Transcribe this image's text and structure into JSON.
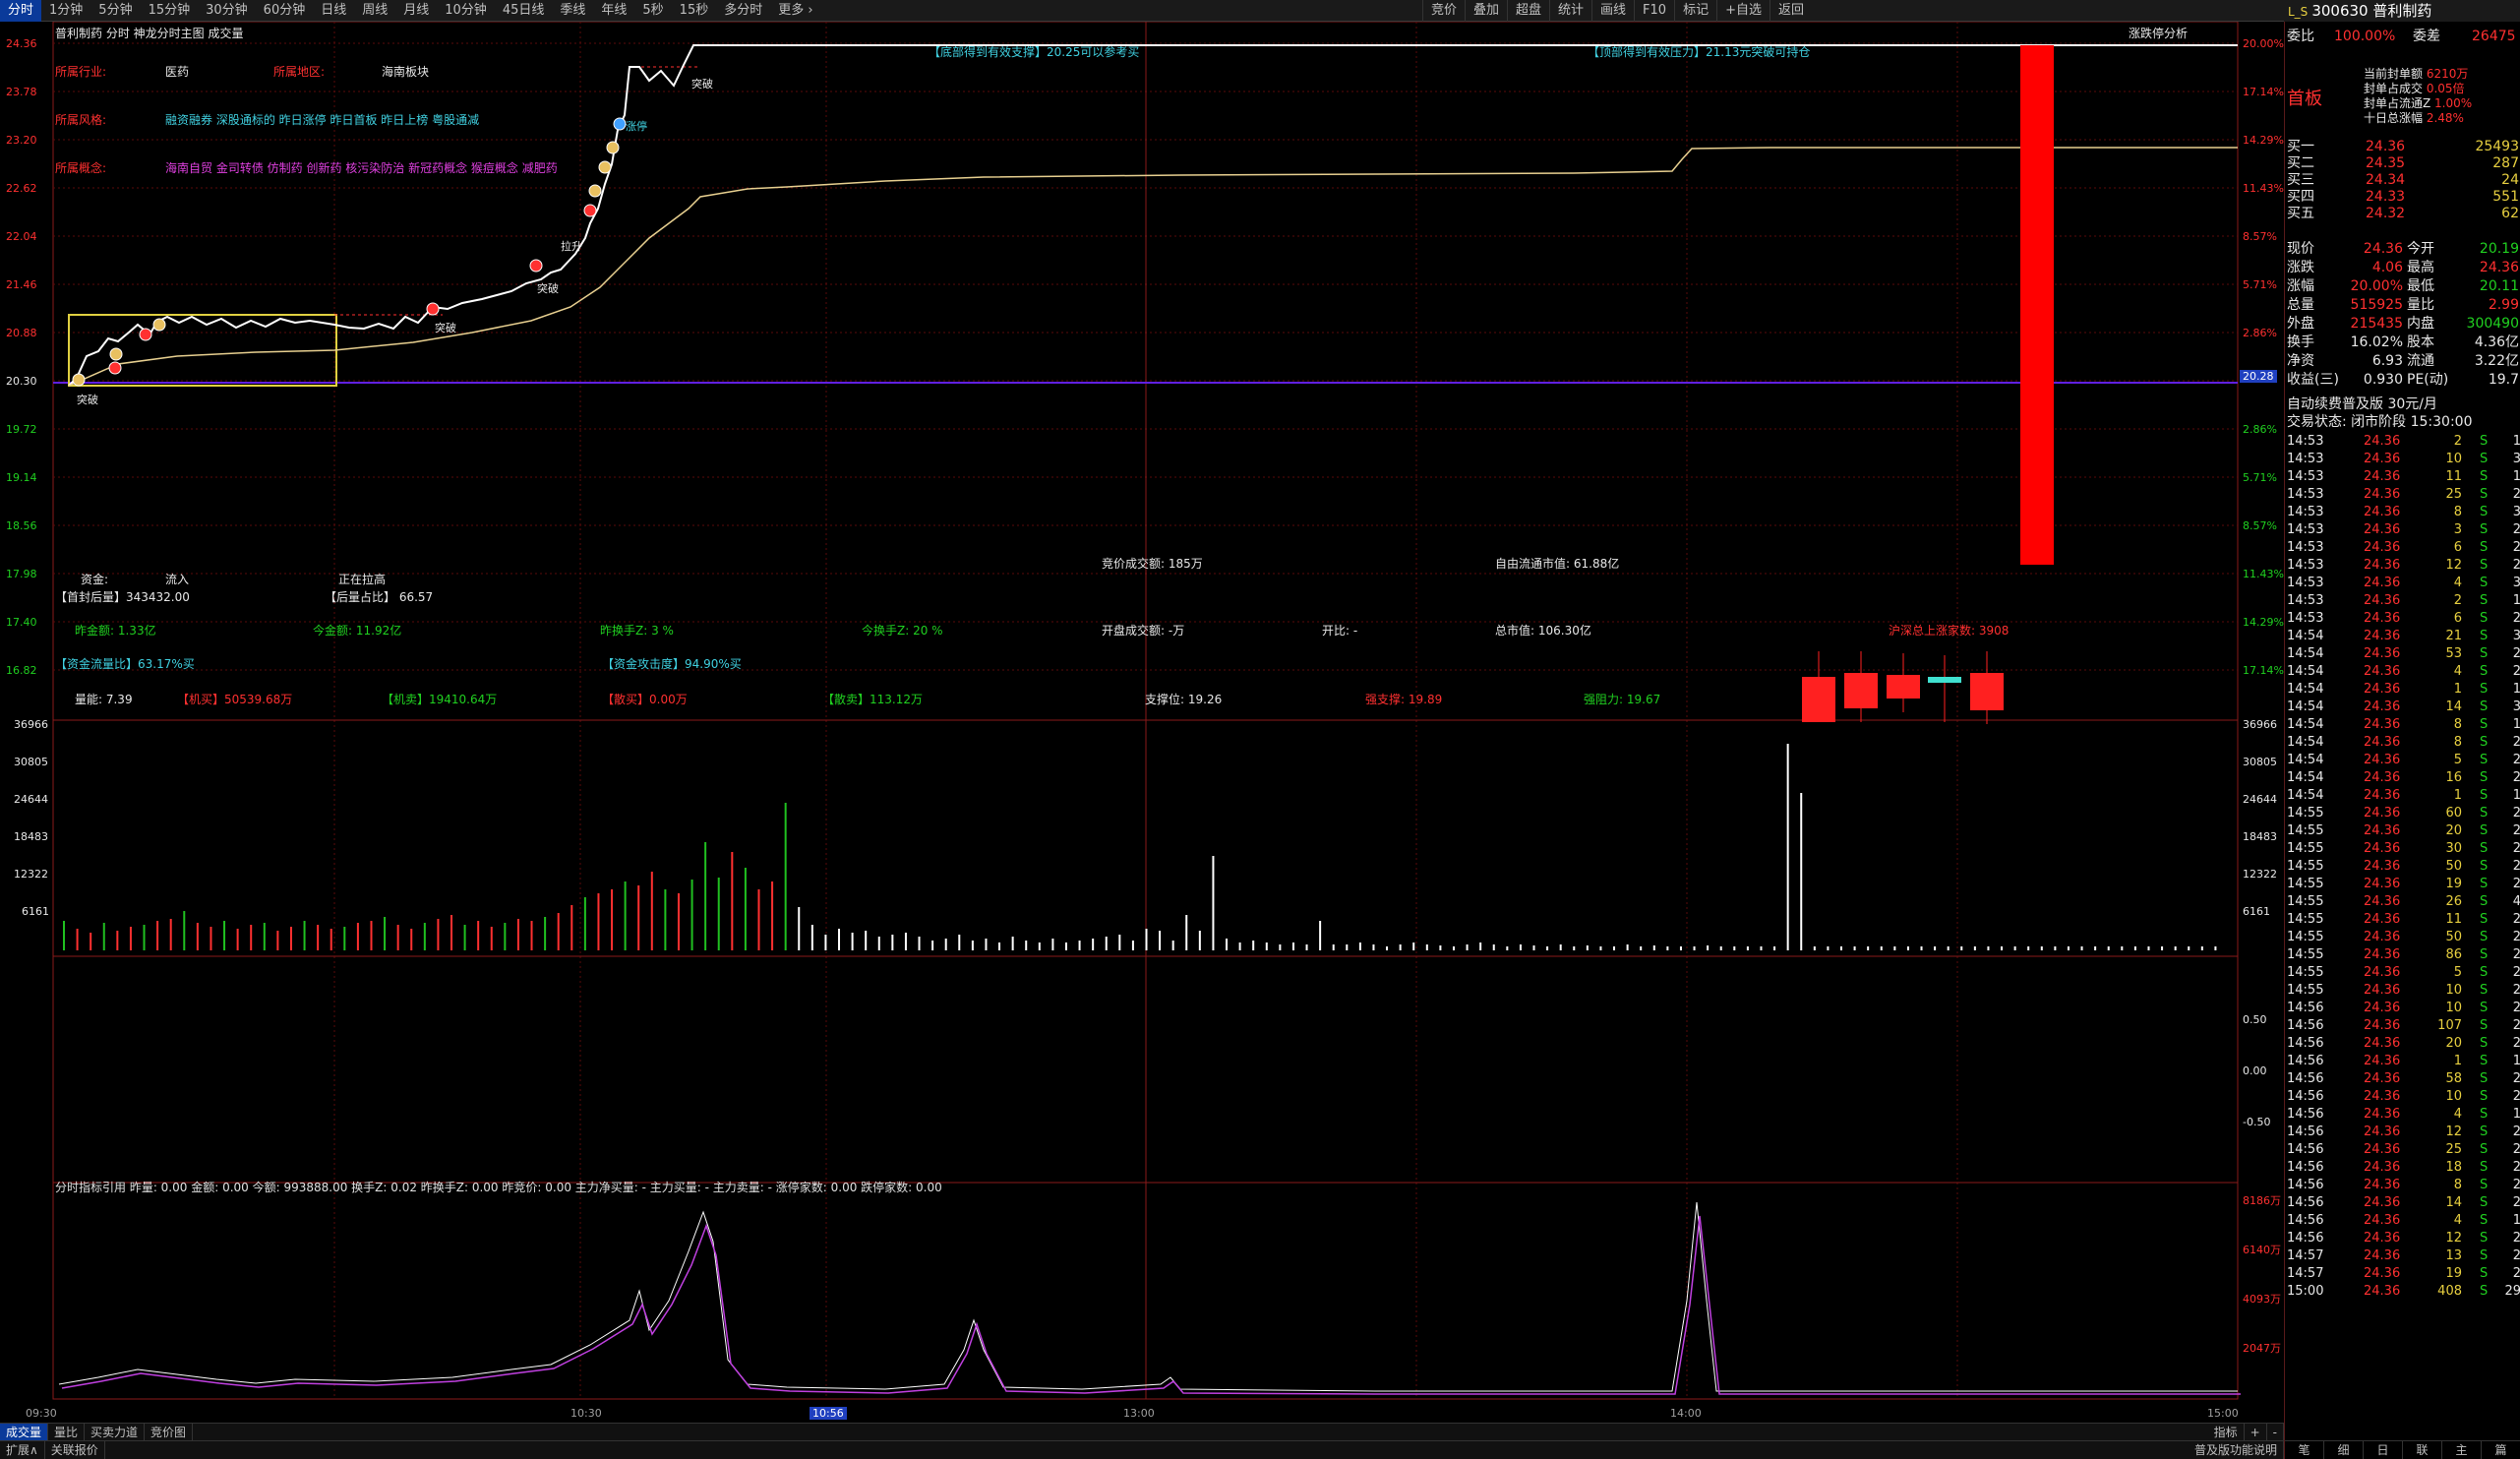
{
  "toolbar": {
    "tabs": [
      "分时",
      "1分钟",
      "5分钟",
      "15分钟",
      "30分钟",
      "60分钟",
      "日线",
      "周线",
      "月线",
      "10分钟",
      "45日线",
      "季线",
      "年线",
      "5秒",
      "15秒",
      "多分时",
      "更多 ›"
    ],
    "right_tabs": [
      "竞价",
      "叠加",
      "超盘",
      "统计",
      "画线",
      "F10",
      "标记",
      "+自选",
      "返回"
    ]
  },
  "stock": {
    "code": "300630",
    "name": "普利制药",
    "header": "300630 普利制药"
  },
  "chart_header": {
    "title": "普利制药  分时  神龙分时主图  成交量",
    "right": "涨跌停分析"
  },
  "info": {
    "industry_label": "所属行业:",
    "industry": "医药",
    "region_label": "所属地区:",
    "region": "海南板块",
    "style_label": "所属风格:",
    "style": "融资融券 深股通标的 昨日涨停 昨日首板 昨日上榜 粤股通减",
    "concept_label": "所属概念:",
    "concept": "海南自贸 金司转债 仿制药 创新药 核污染防治 新冠药概念 猴痘概念 减肥药"
  },
  "banners": {
    "support": "【底部得到有效支撑】20.25可以参考买",
    "resist": "【顶部得到有效压力】21.13元突破可持仓"
  },
  "markers": {
    "tupo1": "突破",
    "tupo2": "突破",
    "tupo3": "突破",
    "lasheng": "拉升",
    "tupo4": "突破",
    "zhangting": "涨停"
  },
  "price_axis": [
    "24.36",
    "23.78",
    "23.20",
    "22.62",
    "22.04",
    "21.46",
    "20.88",
    "20.30",
    "19.72",
    "19.14",
    "18.56",
    "17.98",
    "17.40",
    "16.82"
  ],
  "pct_axis": [
    "20.00%",
    "17.14%",
    "14.29%",
    "11.43%",
    "8.57%",
    "5.71%",
    "2.86%",
    "",
    "2.86%",
    "5.71%",
    "8.57%",
    "11.43%",
    "14.29%",
    "17.14%"
  ],
  "price_tag": "20.28",
  "stats": {
    "zijin": "资金:",
    "liuru": "流入",
    "zhengzai": "正在拉高",
    "jingjia": "竞价成交额: 185万",
    "free_cap": "自由流通市值: 61.88亿",
    "shoufeng": "【首封后量】343432.00",
    "houliang": "【后量占比】 66.57",
    "zuojin": "昨金额: 1.33亿",
    "jinjin": "今金额: 11.92亿",
    "zuohuan": "昨换手Z: 3 %",
    "jinhuan": "今换手Z: 20 %",
    "kaipan": "开盘成交额: -万",
    "kaibi": "开比: -",
    "zongshi": "总市值: 106.30亿",
    "hutao": "沪深总上涨家数: 3908",
    "liuliang": "【资金流量比】63.17%买",
    "gongji": "【资金攻击度】94.90%买",
    "liangneng": "量能: 7.39",
    "jimai": "【机买】50539.68万",
    "jimai2": "【机卖】19410.64万",
    "sanmai": "【散买】0.00万",
    "sanmai2": "【散卖】113.12万",
    "zhicheng": "支撑位: 19.26",
    "qiangzhi": "强支撑: 19.89",
    "qiangzu": "强阻力: 19.67"
  },
  "vol_axis": [
    "36966",
    "30805",
    "24644",
    "18483",
    "12322",
    "6161"
  ],
  "ind_axis": [
    "0.50",
    "0.00",
    "-0.50"
  ],
  "ind2_header": "分时指标引用  昨量: 0.00  金额: 0.00  今额: 993888.00  换手Z: 0.02  昨换手Z: 0.00  昨竞价: 0.00  主力净买量: -  主力买量: -  主力卖量: -  涨停家数: 0.00  跌停家数: 0.00",
  "ind2_axis": [
    "8186万",
    "6140万",
    "4093万",
    "2047万"
  ],
  "time_axis": [
    "09:30",
    "10:30",
    "10:56",
    "13:00",
    "14:00",
    "15:00"
  ],
  "bottom_tabs": [
    "成交量",
    "量比",
    "买卖力道",
    "竞价图"
  ],
  "bottom_tabs2": [
    "扩展∧",
    "关联报价"
  ],
  "bottom_right": [
    "指标",
    "+",
    "-"
  ],
  "bottom_right2": "普及版功能说明",
  "sidebar": {
    "weibi": {
      "label": "委比",
      "value": "100.00%",
      "label2": "委差",
      "value2": "26475"
    },
    "shouban": "首板",
    "feng": [
      {
        "k": "当前封单额",
        "v": "6210万"
      },
      {
        "k": "封单占成交",
        "v": "0.05倍"
      },
      {
        "k": "封单占流通Z",
        "v": "1.00%"
      },
      {
        "k": "十日总涨幅",
        "v": "2.48%"
      }
    ],
    "buy": [
      {
        "k": "买一",
        "p": "24.36",
        "v": "25493"
      },
      {
        "k": "买二",
        "p": "24.35",
        "v": "287"
      },
      {
        "k": "买三",
        "p": "24.34",
        "v": "24"
      },
      {
        "k": "买四",
        "p": "24.33",
        "v": "551"
      },
      {
        "k": "买五",
        "p": "24.32",
        "v": "62"
      }
    ],
    "quote": [
      {
        "k1": "现价",
        "v1": "24.36",
        "k2": "今开",
        "v2": "20.19"
      },
      {
        "k1": "涨跌",
        "v1": "4.06",
        "k2": "最高",
        "v2": "24.36"
      },
      {
        "k1": "涨幅",
        "v1": "20.00%",
        "k2": "最低",
        "v2": "20.11"
      },
      {
        "k1": "总量",
        "v1": "515925",
        "k2": "量比",
        "v2": "2.99"
      },
      {
        "k1": "外盘",
        "v1": "215435",
        "k2": "内盘",
        "v2": "300490"
      },
      {
        "k1": "换手",
        "v1": "16.02%",
        "k2": "股本",
        "v2": "4.36亿"
      },
      {
        "k1": "净资",
        "v1": "6.93",
        "k2": "流通",
        "v2": "3.22亿"
      },
      {
        "k1": "收益(三)",
        "v1": "0.930",
        "k2": "PE(动)",
        "v2": "19.7"
      }
    ],
    "fee": "自动续费普及版  30元/月",
    "trade_state": "交易状态: 闭市阶段 15:30:00",
    "ticks": [
      [
        "14:53",
        "24.36",
        "2",
        "S",
        "1"
      ],
      [
        "14:53",
        "24.36",
        "10",
        "S",
        "3"
      ],
      [
        "14:53",
        "24.36",
        "11",
        "S",
        "1"
      ],
      [
        "14:53",
        "24.36",
        "25",
        "S",
        "2"
      ],
      [
        "14:53",
        "24.36",
        "8",
        "S",
        "3"
      ],
      [
        "14:53",
        "24.36",
        "3",
        "S",
        "2"
      ],
      [
        "14:53",
        "24.36",
        "6",
        "S",
        "2"
      ],
      [
        "14:53",
        "24.36",
        "12",
        "S",
        "2"
      ],
      [
        "14:53",
        "24.36",
        "4",
        "S",
        "3"
      ],
      [
        "14:53",
        "24.36",
        "2",
        "S",
        "1"
      ],
      [
        "14:53",
        "24.36",
        "6",
        "S",
        "2"
      ],
      [
        "14:54",
        "24.36",
        "21",
        "S",
        "3"
      ],
      [
        "14:54",
        "24.36",
        "53",
        "S",
        "2"
      ],
      [
        "14:54",
        "24.36",
        "4",
        "S",
        "2"
      ],
      [
        "14:54",
        "24.36",
        "1",
        "S",
        "1"
      ],
      [
        "14:54",
        "24.36",
        "14",
        "S",
        "3"
      ],
      [
        "14:54",
        "24.36",
        "8",
        "S",
        "1"
      ],
      [
        "14:54",
        "24.36",
        "8",
        "S",
        "2"
      ],
      [
        "14:54",
        "24.36",
        "5",
        "S",
        "2"
      ],
      [
        "14:54",
        "24.36",
        "16",
        "S",
        "2"
      ],
      [
        "14:54",
        "24.36",
        "1",
        "S",
        "1"
      ],
      [
        "14:55",
        "24.36",
        "60",
        "S",
        "2"
      ],
      [
        "14:55",
        "24.36",
        "20",
        "S",
        "2"
      ],
      [
        "14:55",
        "24.36",
        "30",
        "S",
        "2"
      ],
      [
        "14:55",
        "24.36",
        "50",
        "S",
        "2"
      ],
      [
        "14:55",
        "24.36",
        "19",
        "S",
        "2"
      ],
      [
        "14:55",
        "24.36",
        "26",
        "S",
        "4"
      ],
      [
        "14:55",
        "24.36",
        "11",
        "S",
        "2"
      ],
      [
        "14:55",
        "24.36",
        "50",
        "S",
        "2"
      ],
      [
        "14:55",
        "24.36",
        "86",
        "S",
        "2"
      ],
      [
        "14:55",
        "24.36",
        "5",
        "S",
        "2"
      ],
      [
        "14:55",
        "24.36",
        "10",
        "S",
        "2"
      ],
      [
        "14:56",
        "24.36",
        "10",
        "S",
        "2"
      ],
      [
        "14:56",
        "24.36",
        "107",
        "S",
        "2"
      ],
      [
        "14:56",
        "24.36",
        "20",
        "S",
        "2"
      ],
      [
        "14:56",
        "24.36",
        "1",
        "S",
        "1"
      ],
      [
        "14:56",
        "24.36",
        "58",
        "S",
        "2"
      ],
      [
        "14:56",
        "24.36",
        "10",
        "S",
        "2"
      ],
      [
        "14:56",
        "24.36",
        "4",
        "S",
        "1"
      ],
      [
        "14:56",
        "24.36",
        "12",
        "S",
        "2"
      ],
      [
        "14:56",
        "24.36",
        "25",
        "S",
        "2"
      ],
      [
        "14:56",
        "24.36",
        "18",
        "S",
        "2"
      ],
      [
        "14:56",
        "24.36",
        "8",
        "S",
        "2"
      ],
      [
        "14:56",
        "24.36",
        "14",
        "S",
        "2"
      ],
      [
        "14:56",
        "24.36",
        "4",
        "S",
        "1"
      ],
      [
        "14:56",
        "24.36",
        "12",
        "S",
        "2"
      ],
      [
        "14:57",
        "24.36",
        "13",
        "S",
        "2"
      ],
      [
        "14:57",
        "24.36",
        "19",
        "S",
        "2"
      ],
      [
        "15:00",
        "24.36",
        "408",
        "S",
        "29"
      ]
    ],
    "bottom_tabs": [
      "笔",
      "细",
      "日",
      "联",
      "主",
      "篇"
    ]
  },
  "colors": {
    "up": "#ff3030",
    "down": "#20d020",
    "price_line": "#ffffff",
    "avg_line": "#e8d090",
    "grid": "#5a0a0a",
    "axis_border": "#8a1a1a",
    "purple": "#6020e0"
  }
}
